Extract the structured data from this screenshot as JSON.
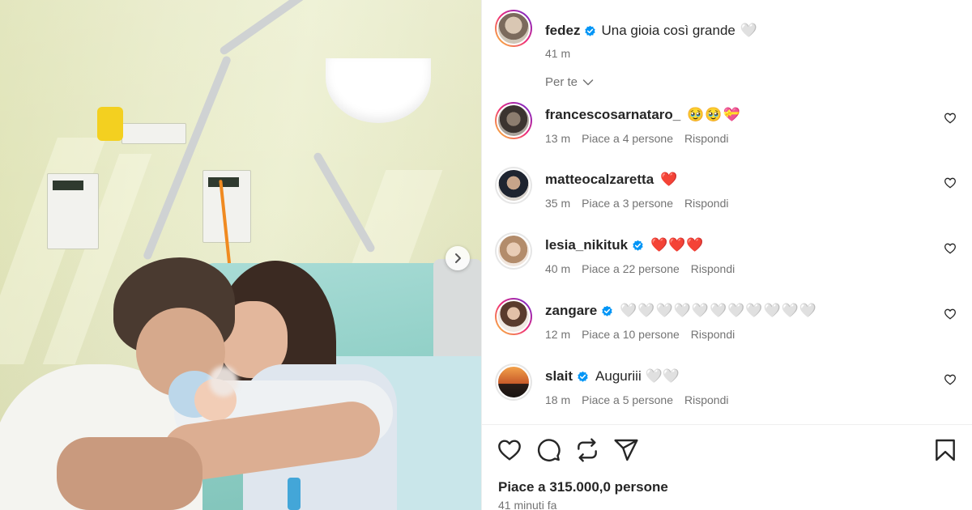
{
  "post": {
    "username": "fedez",
    "caption": "Una gioia così grande",
    "caption_emoji": "🤍",
    "time": "41 m"
  },
  "filter": {
    "label": "Per te"
  },
  "comments": [
    {
      "username": "francescosarnataro_",
      "verified": false,
      "text": "🥹🥹💝",
      "time": "13 m",
      "likes": "Piace a 4 persone",
      "reply": "Rispondi"
    },
    {
      "username": "matteocalzaretta",
      "verified": false,
      "text": "❤️",
      "time": "35 m",
      "likes": "Piace a 3 persone",
      "reply": "Rispondi"
    },
    {
      "username": "lesia_nikituk",
      "verified": true,
      "text": "❤️❤️❤️",
      "time": "40 m",
      "likes": "Piace a 22 persone",
      "reply": "Rispondi"
    },
    {
      "username": "zangare",
      "verified": true,
      "text": "🤍🤍🤍🤍🤍🤍🤍🤍🤍🤍🤍",
      "time": "12 m",
      "likes": "Piace a 10 persone",
      "reply": "Rispondi"
    },
    {
      "username": "slait",
      "verified": true,
      "text": "Auguriii 🤍🤍",
      "time": "18 m",
      "likes": "Piace a 5 persone",
      "reply": "Rispondi"
    }
  ],
  "footer": {
    "likes": "Piace a 315.000,0 persone",
    "posted": "41 minuti fa"
  },
  "icons": {
    "like": "heart-icon",
    "comment": "comment-icon",
    "repost": "repost-icon",
    "share": "share-icon",
    "save": "bookmark-icon",
    "verified": "verified-badge-icon",
    "next": "chevron-right-icon"
  },
  "colors": {
    "verified": "#0095f6",
    "text": "#262626",
    "secondary": "#737373"
  }
}
